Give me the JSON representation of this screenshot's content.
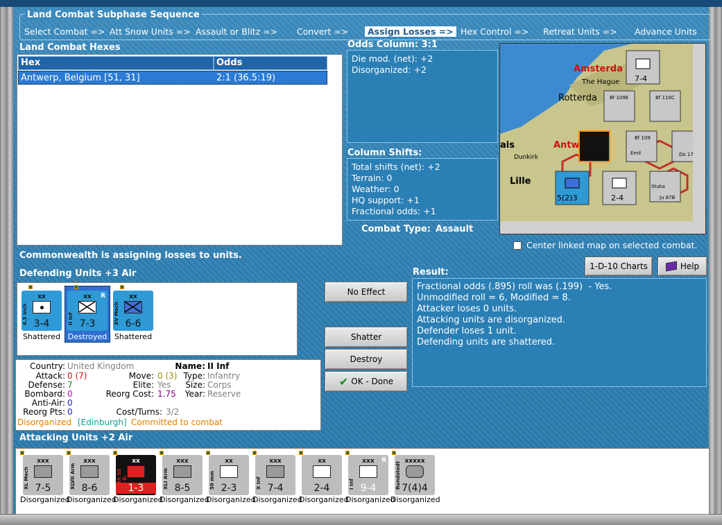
{
  "sequence": {
    "title": "Land Combat Subphase Sequence",
    "steps": [
      "Select Combat =>",
      "Att Snow Units =>",
      "Assault or Blitz =>",
      "Convert =>",
      "Assign Losses =>",
      "Hex Control =>",
      "Retreat Units =>",
      "Advance Units"
    ],
    "selected": "Assign Losses =>"
  },
  "hexes": {
    "title": "Land Combat Hexes",
    "columns": [
      "Hex",
      "Odds"
    ],
    "rows": [
      {
        "hex": "Antwerp, Belgium [51, 31]",
        "odds": "2:1 (36.5:19)"
      }
    ]
  },
  "odds_column": {
    "title": "Odds Column: 3:1",
    "lines": [
      "Die mod. (net): +2",
      "Disorganized: +2"
    ]
  },
  "column_shifts": {
    "title": "Column Shifts:",
    "lines": [
      "Total shifts (net): +2",
      "Terrain: 0",
      "Weather: 0",
      "HQ support: +1",
      "Fractional odds: +1"
    ]
  },
  "combat_type": {
    "label": "Combat Type:",
    "value": "Assault"
  },
  "center_map": {
    "label": "Center linked map on selected combat.",
    "checked": false
  },
  "status": "Commonwealth is assigning losses to units.",
  "buttons": {
    "charts": "1-D-10 Charts",
    "help": "Help",
    "no_effect": "No Effect",
    "shatter": "Shatter",
    "destroy": "Destroy",
    "ok": "OK - Done"
  },
  "defending": {
    "title": "Defending Units +3 Air",
    "units": [
      {
        "name": "4.5 inch",
        "size": "xx",
        "str": "3-4",
        "status": "Shattered",
        "color": "#2f9ad6"
      },
      {
        "name": "II Inf",
        "size": "xx",
        "str": "7-3",
        "status": "Destroyed",
        "color": "#2f9ad6",
        "flag": "R"
      },
      {
        "name": "XV Mech",
        "size": "xx",
        "str": "6-6",
        "status": "Shattered",
        "color": "#2f9ad6"
      }
    ]
  },
  "result": {
    "title": "Result:",
    "lines": [
      "Fractional odds (.895) roll was (.199)  - Yes.",
      "Unmodified roll = 6, Modified = 8.",
      "Attacker loses 0 units.",
      "Attacking units are disorganized.",
      "Defender loses 1 unit.",
      "Defending units are shattered."
    ]
  },
  "info": {
    "country_label": "Country:",
    "country": "United Kingdom",
    "attack_label": "Attack:",
    "attack": "0",
    "attack_paren": "(7)",
    "defense_label": "Defense:",
    "defense": "7",
    "bombard_label": "Bombard:",
    "bombard": "0",
    "antiair_label": "Anti-Air:",
    "antiair": "0",
    "reorg_label": "Reorg Pts:",
    "reorg": "0",
    "name_label": "Name:",
    "name": "II Inf",
    "move_label": "Move:",
    "move": "0 (3)",
    "type_label": "Type:",
    "type": "Infantry",
    "elite_label": "Elite:",
    "elite": "Yes",
    "size_label": "Size:",
    "size": "Corps",
    "reorgcost_label": "Reorg Cost:",
    "reorgcost": "1.75",
    "year_label": "Year:",
    "year": "Reserve",
    "costturns_label": "Cost/Turns:",
    "costturns": "3/2",
    "disorg": "Disorganized",
    "hq": "[Edinburgh]",
    "committed": "Committed to combat"
  },
  "attacking": {
    "title": "Attacking Units +2 Air",
    "units": [
      {
        "name": "XL Mech",
        "size": "xxx",
        "str": "7-5",
        "status": "Disorganized"
      },
      {
        "name": "XLVII Arm",
        "size": "xxx",
        "str": "8-6",
        "status": "Disorganized"
      },
      {
        "name": "14th SS Inf D.",
        "size": "xx",
        "str": "1-3",
        "status": "Disorganized"
      },
      {
        "name": "XLI Arm",
        "size": "xxx",
        "str": "8-5",
        "status": "Disorganized"
      },
      {
        "name": "50 mm",
        "size": "xx",
        "str": "2-3",
        "status": "Disorganized"
      },
      {
        "name": "X Inf",
        "size": "xxx",
        "str": "7-4",
        "status": "Disorganized"
      },
      {
        "name": "",
        "size": "xx",
        "str": "2-4",
        "status": "Disorganized"
      },
      {
        "name": "I Inf",
        "size": "xxx",
        "str": "9-4",
        "status": "Disorganized",
        "flag": "R"
      },
      {
        "name": "Rundstedt",
        "size": "xxxxx",
        "str": "7(4)4",
        "status": "Disorganized"
      }
    ]
  },
  "map": {
    "labels": [
      "Amsterda",
      "The Hague",
      "Rotterda",
      "Antw",
      "Dunkirk",
      "Lille",
      "ais",
      "Bf 109E",
      "Bf 110C",
      "Bf 109",
      "Emil",
      "Do 17",
      "Stuka",
      "Ju 87B"
    ],
    "stacks": [
      "7-4",
      "2-4",
      "5(2)3"
    ]
  }
}
